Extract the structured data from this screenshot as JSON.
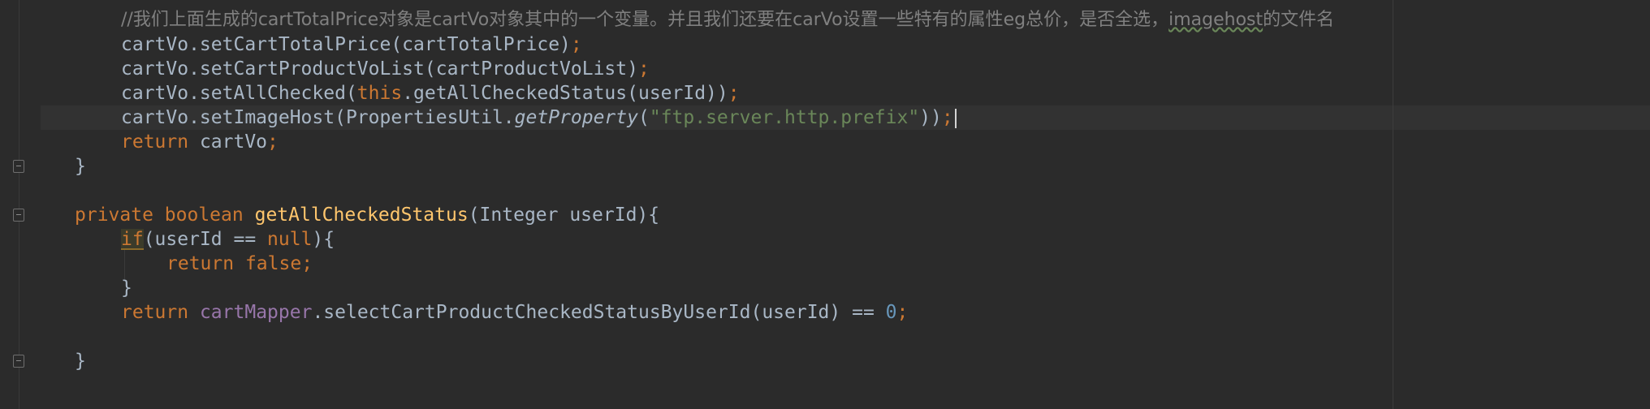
{
  "code": {
    "l0": {
      "text": "//我们上面生成的cartTotalPrice对象是cartVo对象其中的一个变量。并且我们还要在carVo设置一些特有的属性eg总价，是否全选，",
      "typo": "imagehost",
      "tail": "的文件名"
    },
    "l1": {
      "a": "cartVo.setCartTotalPrice(cartTotalPrice)",
      "semi": ";"
    },
    "l2": {
      "a": "cartVo.setCartProductVoList(cartProductVoList)",
      "semi": ";"
    },
    "l3": {
      "a": "cartVo.setAllChecked(",
      "kw": "this",
      "b": ".getAllCheckedStatus(userId))",
      "semi": ";"
    },
    "l4": {
      "a": "cartVo.setImageHost(PropertiesUtil.",
      "fn": "getProperty",
      "b": "(",
      "str": "\"ftp.server.http.prefix\"",
      "c": "))",
      "semi": ";"
    },
    "l5": {
      "kw": "return",
      "a": " cartVo",
      "semi": ";"
    },
    "l6": {
      "a": "}"
    },
    "l7": {
      "kw1": "private",
      "kw2": "boolean",
      "fn": "getAllCheckedStatus",
      "a": "(Integer userId){"
    },
    "l8": {
      "kw": "if",
      "a": "(userId == ",
      "kw2": "null",
      "b": "){"
    },
    "l9": {
      "kw": "return",
      "kw2": "false",
      "semi": ";"
    },
    "l10": {
      "a": "}"
    },
    "l11": {
      "kw": "return",
      "fld": "cartMapper",
      "a": ".selectCartProductCheckedStatusByUserId(userId) == ",
      "num": "0",
      "semi": ";"
    },
    "l12": {
      "a": "}"
    }
  }
}
